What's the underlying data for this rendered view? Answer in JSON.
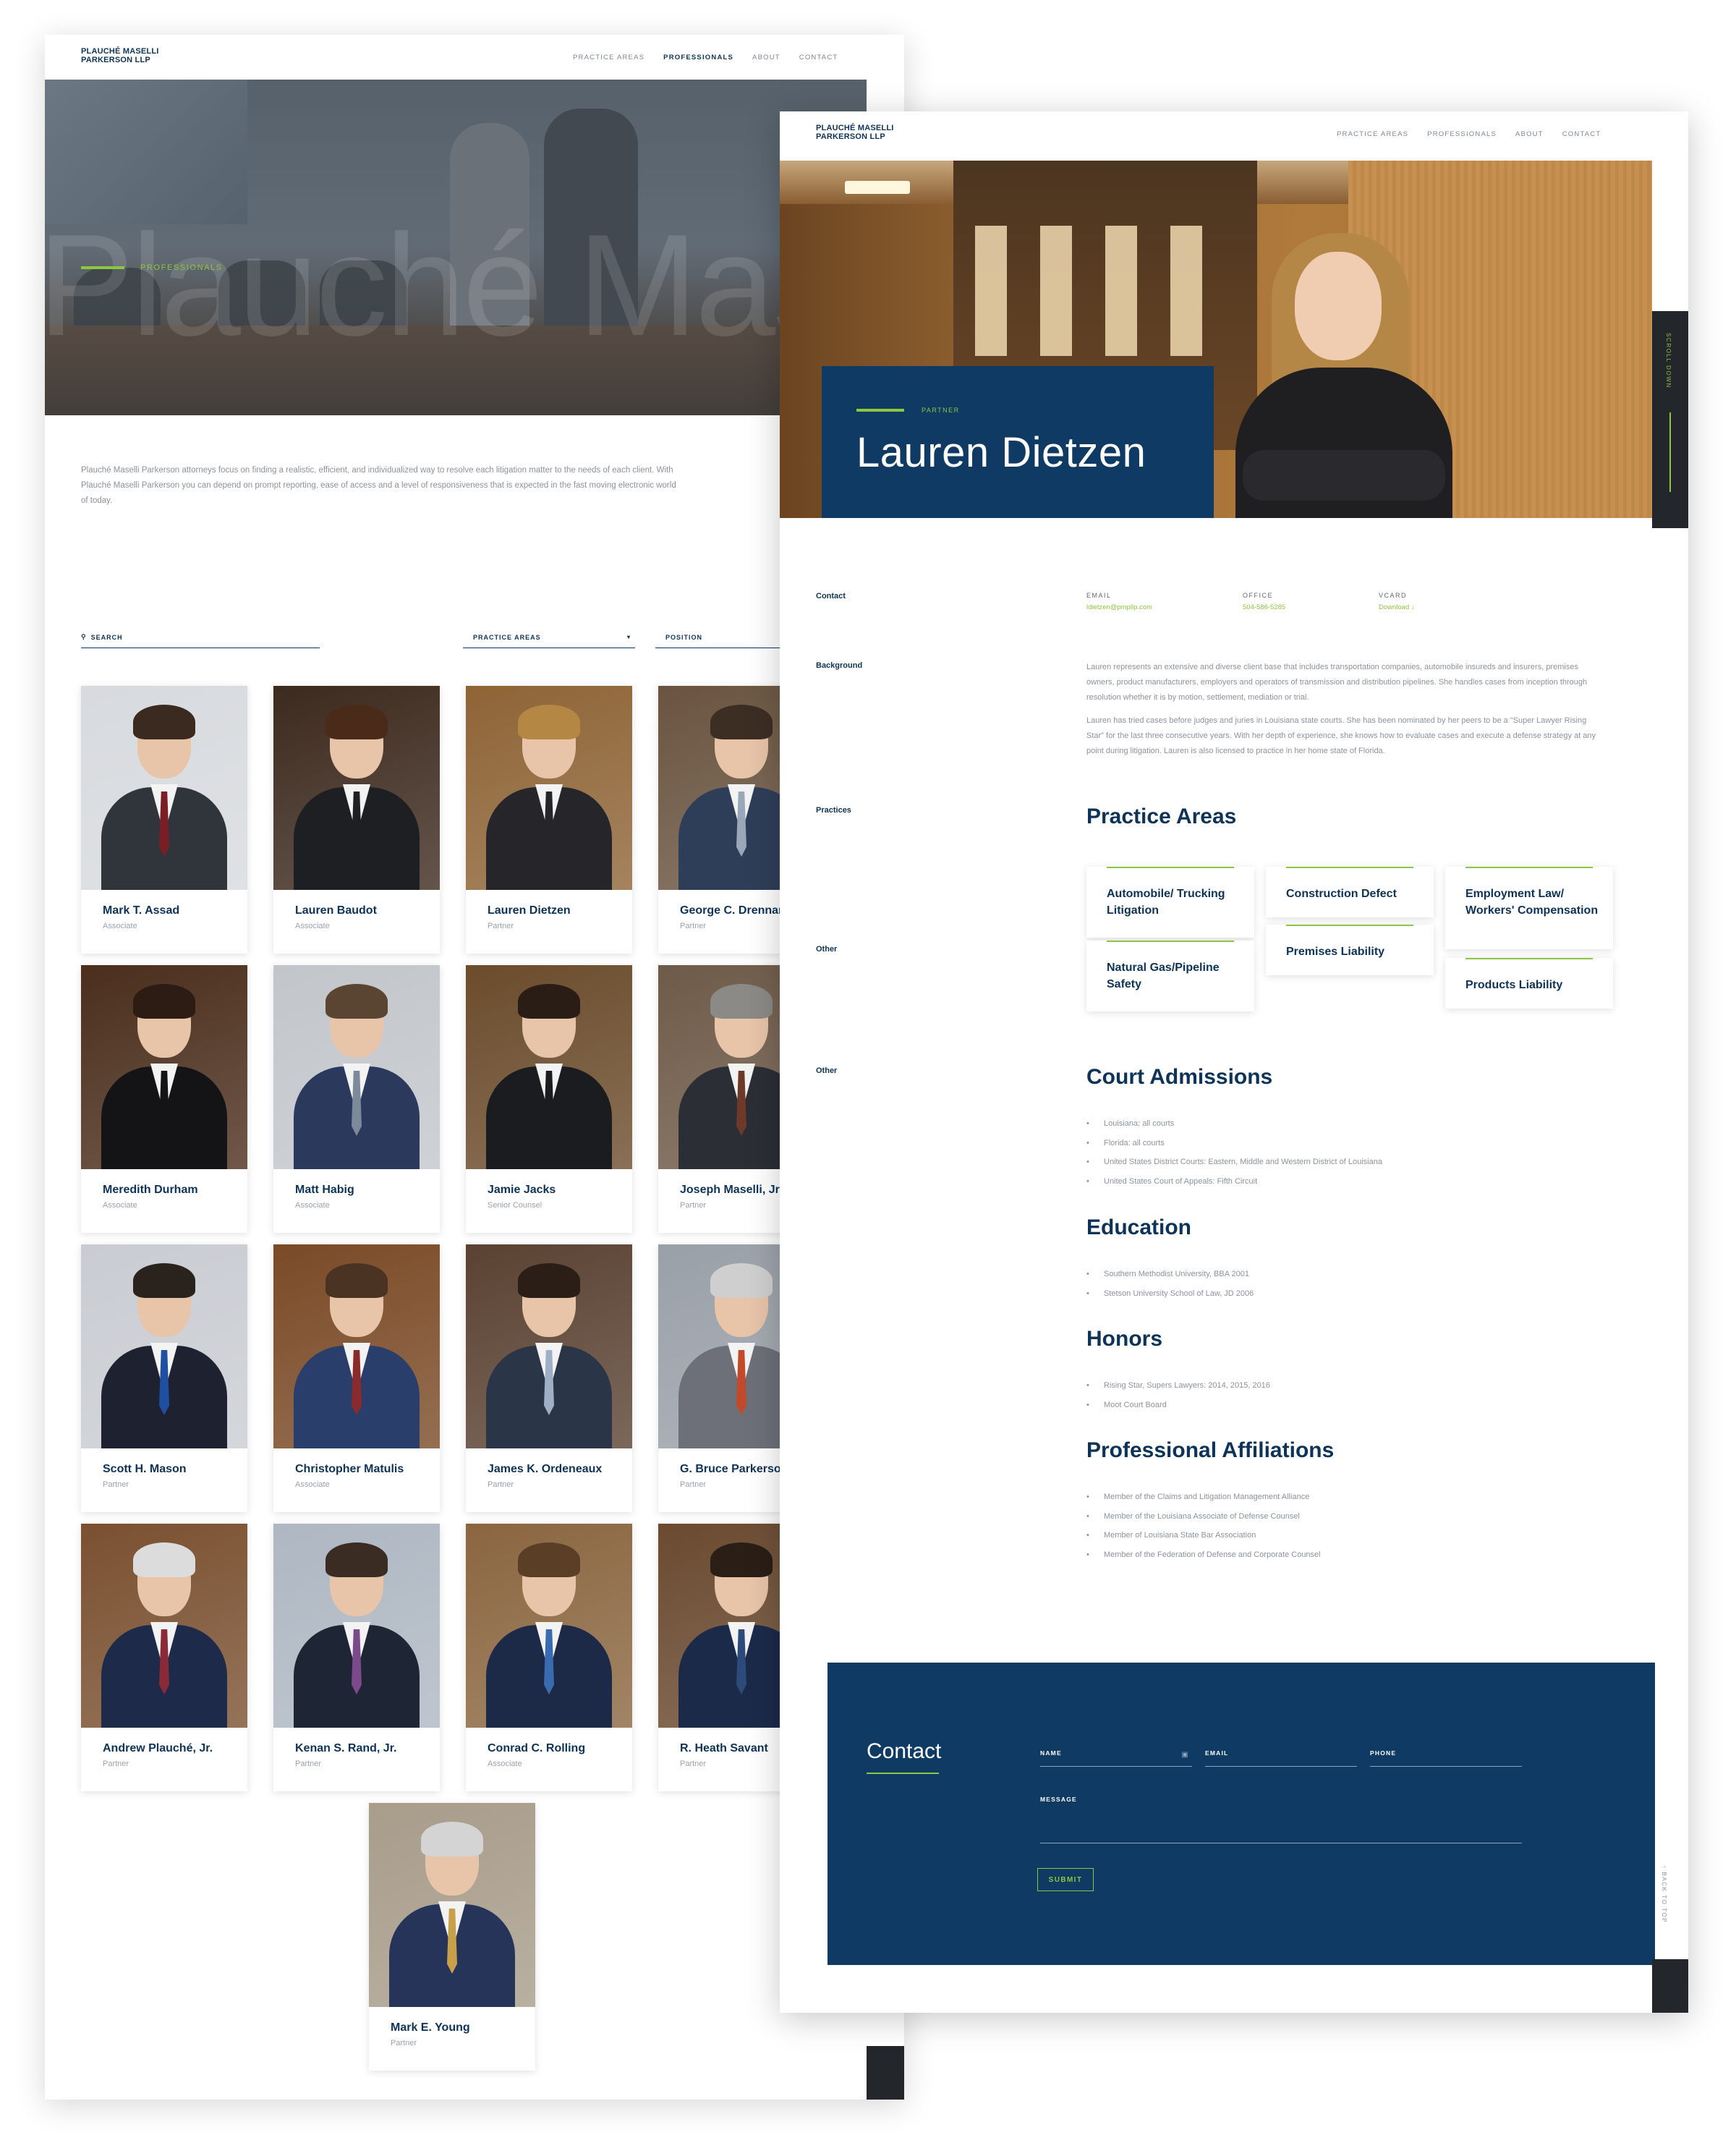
{
  "brand": {
    "line1": "PLAUCHÉ MASELLI",
    "line2": "PARKERSON LLP"
  },
  "nav": {
    "items": [
      "PRACTICE AREAS",
      "PROFESSIONALS",
      "ABOUT",
      "CONTACT"
    ],
    "active_index_list_page": 1
  },
  "list_page": {
    "eyebrow": "PROFESSIONALS",
    "hero_bg_text": "Plauché Maselli",
    "intro": "Plauché Maselli Parkerson attorneys focus on finding a realistic, efficient, and individualized way to resolve each litigation matter to the needs of each client.  With Plauché Maselli Parkerson you can depend on prompt reporting, ease of access and  a level of responsiveness that is expected in the fast moving electronic world of today.",
    "filters": {
      "search": "SEARCH",
      "practice_areas": "PRACTICE AREAS",
      "position": "POSITION"
    },
    "people": [
      {
        "name": "Mark T. Assad",
        "role": "Associate"
      },
      {
        "name": "Lauren Baudot",
        "role": "Associate"
      },
      {
        "name": "Lauren Dietzen",
        "role": "Partner"
      },
      {
        "name": "George C. Drennan",
        "role": "Partner"
      },
      {
        "name": "Meredith Durham",
        "role": "Associate"
      },
      {
        "name": "Matt Habig",
        "role": "Associate"
      },
      {
        "name": "Jamie Jacks",
        "role": "Senior Counsel"
      },
      {
        "name": "Joseph Maselli, Jr.",
        "role": "Partner"
      },
      {
        "name": "Scott H. Mason",
        "role": "Partner"
      },
      {
        "name": "Christopher Matulis",
        "role": "Associate"
      },
      {
        "name": "James K. Ordeneaux",
        "role": "Partner"
      },
      {
        "name": "G. Bruce Parkerson",
        "role": "Partner"
      },
      {
        "name": "Andrew Plauché, Jr.",
        "role": "Partner"
      },
      {
        "name": "Kenan S. Rand, Jr.",
        "role": "Partner"
      },
      {
        "name": "Conrad C. Rolling",
        "role": "Associate"
      },
      {
        "name": "R. Heath Savant",
        "role": "Partner"
      },
      {
        "name": "Mark E. Young",
        "role": "Partner"
      }
    ]
  },
  "profile_page": {
    "position": "PARTNER",
    "name": "Lauren Dietzen",
    "scroll_label": "SCROLL DOWN",
    "back_to_top": "BACK TO TOP",
    "sections": {
      "contact": "Contact",
      "background": "Background",
      "practices": "Practices",
      "other1": "Other",
      "other2": "Other"
    },
    "contact": {
      "email_label": "EMAIL",
      "email": "ldietzen@pmpllp.com",
      "office_label": "OFFICE",
      "office": "504-586-5285",
      "vcard_label": "VCARD",
      "vcard": "Download ↓"
    },
    "background": [
      "Lauren represents an extensive and diverse client base that includes transportation companies, automobile insureds and insurers, premises owners, product manufacturers, employers and operators of transmission and distribution pipelines.  She handles cases from inception through resolution whether it is by motion, settlement, mediation or trial.",
      "Lauren has tried cases before judges and juries in Louisiana state courts.  She has been nominated by her peers to be a \"Super Lawyer Rising Star\" for the last three consecutive years.  With her depth of experience, she knows how to evaluate cases and execute a defense strategy at any point during litigation.  Lauren is also licensed to practice in her home state of Florida."
    ],
    "practice_areas_title": "Practice Areas",
    "practice_areas": [
      "Automobile/ Trucking Litigation",
      "Construction Defect",
      "Employment Law/ Workers' Compensation",
      "Natural Gas/Pipeline Safety",
      "Premises Liability",
      "Products Liability"
    ],
    "court_admissions_title": "Court Admissions",
    "court_admissions": [
      "Louisiana: all courts",
      "Florida: all courts",
      "United States District Courts: Eastern, Middle and Western District of Louisiana",
      "United States Court of Appeals: Fifth Circuit"
    ],
    "education_title": "Education",
    "education": [
      "Southern Methodist University, BBA 2001",
      "Stetson University School of Law, JD 2006"
    ],
    "honors_title": "Honors",
    "honors": [
      "Rising Star, Supers Lawyers: 2014, 2015, 2016",
      "Moot Court Board"
    ],
    "affiliations_title": "Professional Affiliations",
    "affiliations": [
      "Member of the Claims and Litigation Management Alliance",
      "Member of the Louisiana Associate of Defense Counsel",
      "Member of Louisiana State Bar Association",
      "Member of the Federation of Defense and Corporate Counsel"
    ],
    "contact_form": {
      "title": "Contact",
      "name": "NAME",
      "email": "EMAIL",
      "phone": "PHONE",
      "message": "MESSAGE",
      "submit": "SUBMIT"
    }
  },
  "colors": {
    "navy": "#0e3a63",
    "green": "#8dc63f",
    "dark": "#23262a"
  }
}
